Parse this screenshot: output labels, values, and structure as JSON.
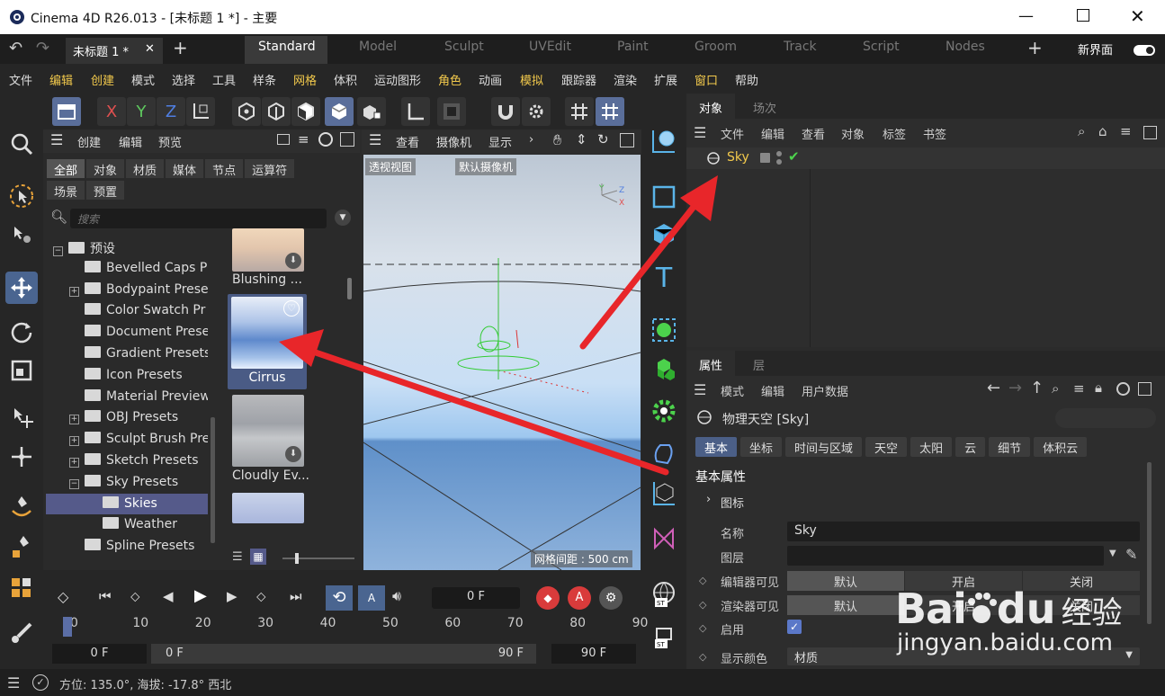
{
  "window": {
    "title": "Cinema 4D R26.013 - [未标题 1 *] - 主要"
  },
  "doc_tab": {
    "label": "未标题 1 *"
  },
  "layouts": [
    "Standard",
    "Model",
    "Sculpt",
    "UVEdit",
    "Paint",
    "Groom",
    "Track",
    "Script",
    "Nodes"
  ],
  "new_layout": "新界面",
  "menu": [
    "文件",
    "编辑",
    "创建",
    "模式",
    "选择",
    "工具",
    "样条",
    "网格",
    "体积",
    "运动图形",
    "角色",
    "动画",
    "模拟",
    "跟踪器",
    "渲染",
    "扩展",
    "窗口",
    "帮助"
  ],
  "asset": {
    "menu": [
      "创建",
      "编辑",
      "预览"
    ],
    "filters": [
      "全部",
      "对象",
      "材质",
      "媒体",
      "节点",
      "运算符"
    ],
    "filters2": [
      "场景",
      "预置"
    ],
    "search_placeholder": "搜索",
    "tree": [
      {
        "label": "预设",
        "indent": 1,
        "toggle": "minus"
      },
      {
        "label": "Bevelled Caps P",
        "indent": 2,
        "toggle": ""
      },
      {
        "label": "Bodypaint Prese",
        "indent": 2,
        "toggle": "plus"
      },
      {
        "label": "Color Swatch Pr",
        "indent": 2,
        "toggle": ""
      },
      {
        "label": "Document Prese",
        "indent": 2,
        "toggle": ""
      },
      {
        "label": "Gradient Presets",
        "indent": 2,
        "toggle": ""
      },
      {
        "label": "Icon Presets",
        "indent": 2,
        "toggle": ""
      },
      {
        "label": "Material Preview",
        "indent": 2,
        "toggle": ""
      },
      {
        "label": "OBJ Presets",
        "indent": 2,
        "toggle": "plus"
      },
      {
        "label": "Sculpt Brush Pre",
        "indent": 2,
        "toggle": "plus"
      },
      {
        "label": "Sketch Presets",
        "indent": 2,
        "toggle": "plus"
      },
      {
        "label": "Sky Presets",
        "indent": 2,
        "toggle": "minus"
      },
      {
        "label": "Skies",
        "indent": 3,
        "toggle": "",
        "selected": true
      },
      {
        "label": "Weather",
        "indent": 3,
        "toggle": ""
      },
      {
        "label": "Spline Presets",
        "indent": 2,
        "toggle": ""
      }
    ],
    "thumbs": [
      "Blushing ...",
      "Cirrus",
      "Cloudly Ev..."
    ]
  },
  "viewport": {
    "menu": [
      "查看",
      "摄像机",
      "显示"
    ],
    "view_name": "透视视图",
    "camera_name": "默认摄像机",
    "grid_info": "网格间距 : 500 cm"
  },
  "objects": {
    "tabs": [
      "对象",
      "场次"
    ],
    "menu": [
      "文件",
      "编辑",
      "查看",
      "对象",
      "标签",
      "书签"
    ],
    "item": "Sky"
  },
  "attributes": {
    "tabs": [
      "属性",
      "层"
    ],
    "menu": [
      "模式",
      "编辑",
      "用户数据"
    ],
    "object_title": "物理天空 [Sky]",
    "subtabs": [
      "基本",
      "坐标",
      "时间与区域",
      "天空",
      "太阳",
      "云",
      "细节",
      "体积云"
    ],
    "section": "基本属性",
    "subsection": "图标",
    "name_label": "名称",
    "name_value": "Sky",
    "layer_label": "图层",
    "editor_vis_label": "编辑器可见",
    "render_vis_label": "渲染器可见",
    "seg_options": [
      "默认",
      "开启",
      "关闭"
    ],
    "enable_label": "启用",
    "display_color_label": "显示颜色",
    "display_color_value": "材质"
  },
  "timeline": {
    "current_frame": "0 F",
    "ticks": [
      "0",
      "10",
      "20",
      "30",
      "40",
      "50",
      "60",
      "70",
      "80",
      "90"
    ],
    "start": "0 F",
    "range_start": "0 F",
    "range_end": "90 F",
    "end": "90 F"
  },
  "status": {
    "text": "方位: 135.0°, 海拔: -17.8°  西北"
  },
  "watermark": {
    "brand": "Bai",
    "brand2": "du",
    "cn": "经验",
    "url": "jingyan.baidu.com"
  },
  "colors": {
    "accent": "#4a6590",
    "arrow": "#e8262a",
    "selected_tab": "#4b5f87"
  }
}
